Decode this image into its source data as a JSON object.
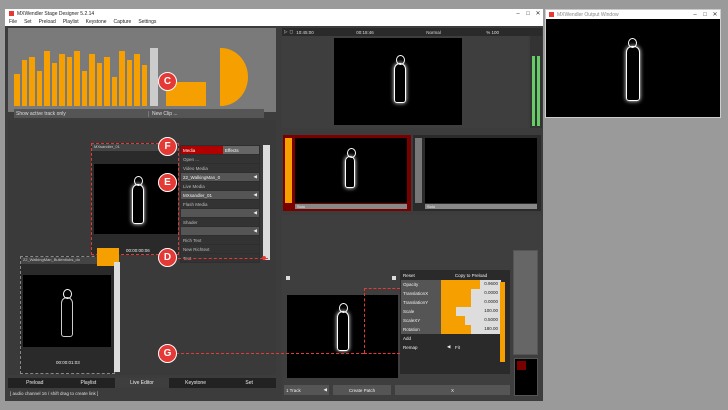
{
  "main_window": {
    "title": "MXWendler Stage Designer 5.2.14",
    "menu": [
      "File",
      "Set",
      "Preload",
      "Playlist",
      "Keystone",
      "Capture",
      "Settings"
    ],
    "controls": [
      "–",
      "□",
      "✕"
    ]
  },
  "output_window": {
    "title": "MXWendler Output Window",
    "controls": [
      "–",
      "□",
      "✕"
    ]
  },
  "top_panel": {
    "show_active_label": "Show active track only",
    "new_clip_label": "New Clip ...",
    "level_bars": [
      0.55,
      0.8,
      0.85,
      0.6,
      0.95,
      0.75,
      0.9,
      0.85,
      0.95,
      0.6,
      0.9,
      0.75,
      0.85,
      0.5,
      0.95,
      0.8,
      0.9,
      0.7
    ]
  },
  "clip_f": {
    "title": "MXsandler_01",
    "time": "00:00:00:06",
    "menu_items": [
      {
        "label": "Media",
        "right": "Effects",
        "highlight": true
      },
      {
        "label": "Open ..."
      },
      {
        "label": "Video Media"
      },
      {
        "label": "22_WalkingMan_0",
        "arrow": true
      },
      {
        "label": "Live Media"
      },
      {
        "label": "MXsandler_01",
        "arrow": true
      },
      {
        "label": "Flash Media"
      },
      {
        "label": "",
        "arrow": true
      },
      {
        "label": "Shader"
      },
      {
        "label": "",
        "arrow": true
      },
      {
        "label": "Rich Text"
      },
      {
        "label": "New Richtext"
      },
      {
        "label": "Text"
      }
    ]
  },
  "clip_g": {
    "title": "22_WalkingMan_Bullentlubs_do",
    "time": "00:00:01:03"
  },
  "bottom_tabs": [
    "Preload",
    "Playlist",
    "Live Editor",
    "Keystone",
    "Set"
  ],
  "active_tab": "Live Editor",
  "status_text": "[ audio channel 16 / shift drag to create link ]",
  "transport": {
    "time": "10:45:00",
    "clip_time": "00:18:46",
    "mode": "Normal",
    "zoom": "% 100"
  },
  "slots": [
    {
      "label": "Solo",
      "active": true
    },
    {
      "label": "Solo",
      "active": false
    }
  ],
  "properties": {
    "reset_label": "Reset",
    "copy_label": "Copy to Preload",
    "rows": [
      {
        "label": "Opacity",
        "value": "0.9600",
        "fill": 0.65
      },
      {
        "label": "TranslationX",
        "value": "0.0000",
        "fill": 0.5
      },
      {
        "label": "TranslationY",
        "value": "0.0000",
        "fill": 0.5
      },
      {
        "label": "Scale",
        "value": "100.00",
        "fill": 0.25
      },
      {
        "label": "ScaleXY",
        "value": "0.5000",
        "fill": 0.4
      },
      {
        "label": "Rotation",
        "value": "180.00",
        "fill": 0.5
      }
    ],
    "add_label": "Add",
    "remap_label": "Remap",
    "remap_value": "Fit"
  },
  "bottom_controls": {
    "track_label": "1 Track",
    "create_patch_label": "Create Patch",
    "x_label": "X"
  },
  "callouts": [
    "C",
    "F",
    "E",
    "D",
    "G"
  ]
}
